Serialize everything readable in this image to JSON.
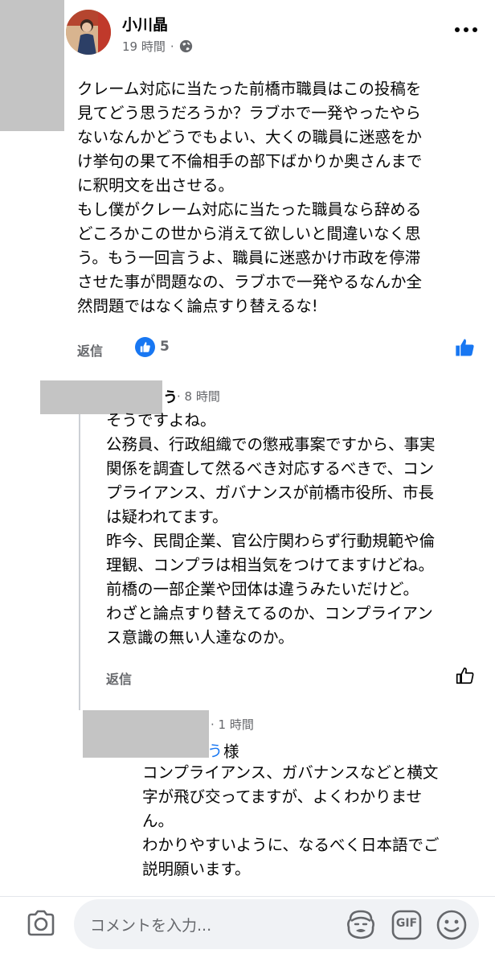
{
  "post": {
    "author": "小川晶",
    "time": "19 時間",
    "dot": "·",
    "body": "クレーム対応に当たった前橋市職員はこの投稿を\n見てどう思うだろうか？ラブホで一発やったやら\nないなんかどうでもよい、大くの職員に迷惑をか\nけ挙句の果て不倫相手の部下ばかりか奥さんまで\nに釈明文を出させる。\nもし僕がクレーム対応に当たった職員なら辞める\nどころかこの世から消えて欲しいと間違いなく思\nう。もう一回言うよ、職員に迷惑かけ市政を停滞\nさせた事が問題なの、ラブホで一発やるなんか全\n然問題ではなく論点すり替えるな!",
    "reply_label": "返信",
    "like_count": "5"
  },
  "reply1": {
    "name_tail": "う",
    "time": "· 8 時間",
    "body": "そうですよね。\n公務員、行政組織での懲戒事案ですから、事実\n関係を調査して然るべき対応するべきで、コン\nプライアンス、ガバナンスが前橋市役所、市長\nは疑われてます。\n昨今、民間企業、官公庁関わらず行動規範や倫\n理観、コンプラは相当気をつけてますけどね。\n前橋の一部企業や団体は違うみたいだけど。\nわざと論点すり替えてるのか、コンプライアン\nス意識の無い人達なのか。",
    "reply_label": "返信"
  },
  "reply2": {
    "time": "· 1 時間",
    "mention_tail": "う",
    "honorific": "様",
    "body": "コンプライアンス、ガバナンスなどと横文\n字が飛び交ってますが、よくわかりませ\nん。\nわかりやすいように、なるべく日本語でご\n説明願います。"
  },
  "composer": {
    "placeholder": "コメントを入力...",
    "gif_label": "GIF"
  },
  "icons": {
    "globe": "globe-icon",
    "more": "more-options-icon",
    "like": "like-icon",
    "camera": "camera-icon",
    "avatar_sticker": "avatar-sticker-icon",
    "gif": "gif-icon",
    "emoji": "emoji-icon"
  },
  "colors": {
    "accent": "#1877f2",
    "secondary_text": "#65676b",
    "input_bg": "#f0f2f5"
  }
}
